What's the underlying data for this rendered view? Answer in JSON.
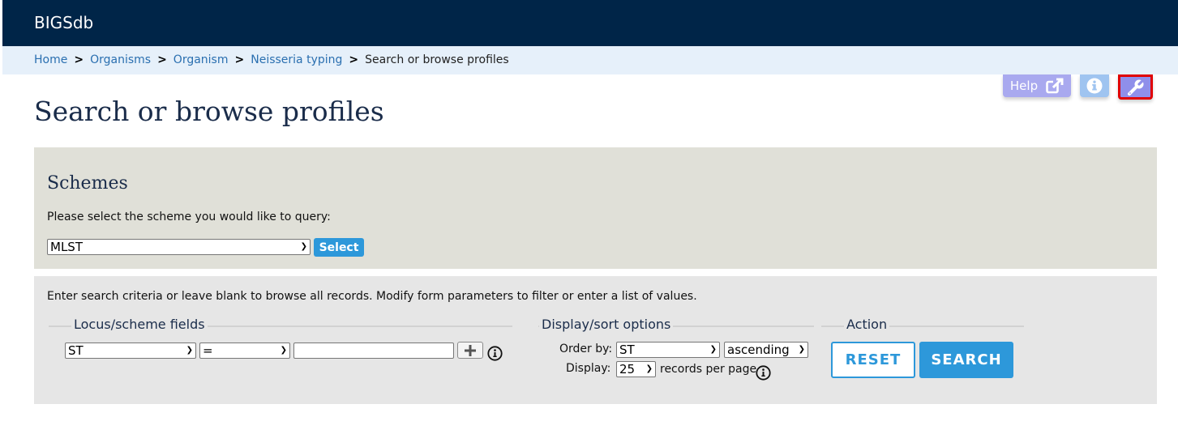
{
  "app": {
    "brand": "BIGSdb"
  },
  "breadcrumb": [
    {
      "label": "Home"
    },
    {
      "label": "Organisms"
    },
    {
      "label": "Organism"
    },
    {
      "label": "Neisseria typing"
    },
    {
      "label": "Search or browse profiles"
    }
  ],
  "toolbar": {
    "help_label": "Help",
    "icons": [
      "external-link-icon",
      "info-icon",
      "wrench-icon"
    ]
  },
  "page": {
    "title": "Search or browse profiles"
  },
  "schemes": {
    "heading": "Schemes",
    "prompt": "Please select the scheme you would like to query:",
    "selected": "MLST",
    "select_button": "Select"
  },
  "search": {
    "instructions": "Enter search criteria or leave blank to browse all records. Modify form parameters to filter or enter a list of values.",
    "locus_fields": {
      "legend": "Locus/scheme fields",
      "field": "ST",
      "operator": "=",
      "value": ""
    },
    "display_sort": {
      "legend": "Display/sort options",
      "order_by_label": "Order by:",
      "order_by": "ST",
      "direction": "ascending",
      "display_label": "Display:",
      "display_count": "25",
      "records_suffix": "records per page"
    },
    "action": {
      "legend": "Action",
      "reset": "RESET",
      "search": "SEARCH"
    }
  },
  "colors": {
    "topbar": "#002548",
    "breadcrumb_bg": "#e6f0fa",
    "link": "#2a6fb0",
    "accent": "#2d98da",
    "schemes_bg": "#e0e0d8",
    "search_bg": "#e6e6e6",
    "highlight": "#e00000"
  }
}
